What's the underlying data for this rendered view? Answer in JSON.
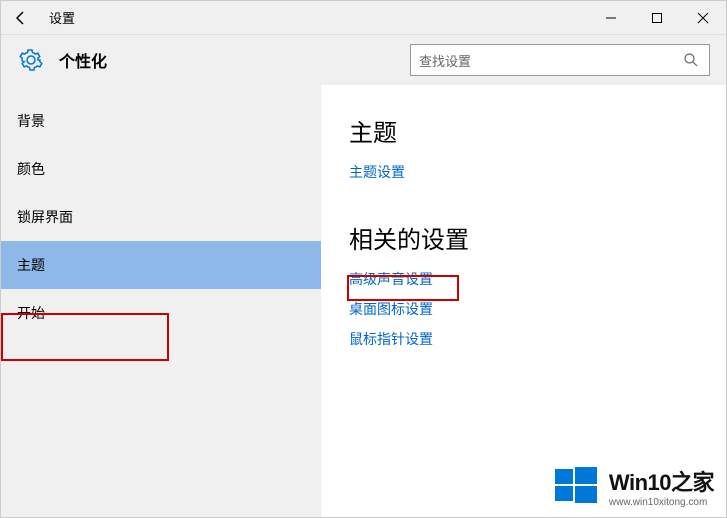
{
  "titlebar": {
    "title": "设置"
  },
  "header": {
    "title": "个性化"
  },
  "search": {
    "placeholder": "查找设置"
  },
  "sidebar": {
    "items": [
      {
        "label": "背景"
      },
      {
        "label": "颜色"
      },
      {
        "label": "锁屏界面"
      },
      {
        "label": "主题"
      },
      {
        "label": "开始"
      }
    ],
    "selected_index": 3
  },
  "main": {
    "section1_title": "主题",
    "section1_links": [
      {
        "label": "主题设置"
      }
    ],
    "section2_title": "相关的设置",
    "section2_links": [
      {
        "label": "高级声音设置"
      },
      {
        "label": "桌面图标设置"
      },
      {
        "label": "鼠标指针设置"
      }
    ]
  },
  "watermark": {
    "title": "Win10之家",
    "subtitle": "www.win10xitong.com"
  }
}
